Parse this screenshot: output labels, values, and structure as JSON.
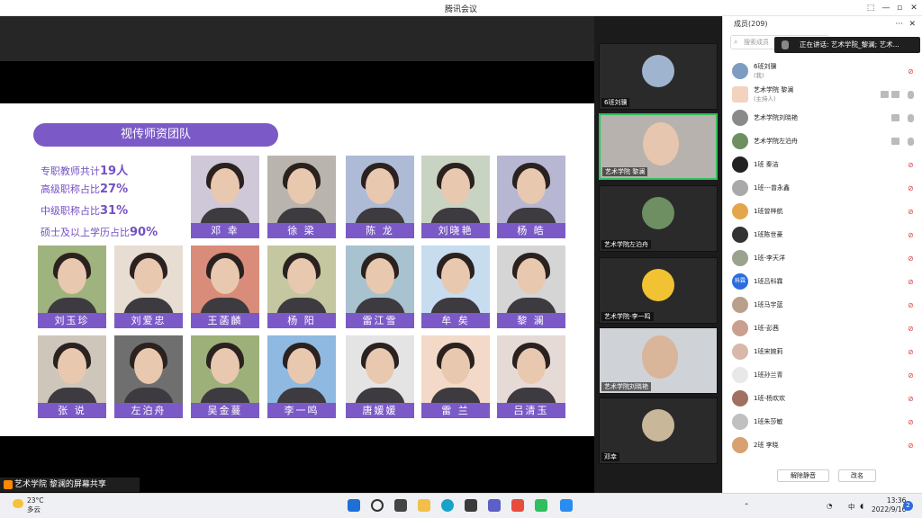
{
  "window": {
    "title": "腾讯会议",
    "controls": [
      "⬚",
      "—",
      "▫",
      "✕"
    ]
  },
  "slide": {
    "title": "视传师资团队",
    "stats": [
      {
        "label": "专职教师共计",
        "value": "19人"
      },
      {
        "label": "高级职称占比",
        "value": "27%"
      },
      {
        "label": "中级职称占比",
        "value": "31%"
      },
      {
        "label": "硕士及以上学历占比",
        "value": "90%"
      }
    ],
    "teachers": [
      "邓 幸",
      "徐 梁",
      "陈 龙",
      "刘晓艳",
      "杨 皓",
      "刘玉珍",
      "刘爱忠",
      "王菡麟",
      "杨 阳",
      "雷江雪",
      "牟 矣",
      "黎 澜",
      "张 说",
      "左泊舟",
      "吴金蔓",
      "李一鸣",
      "唐媛媛",
      "雷 兰",
      "吕清玉"
    ]
  },
  "share_status": "艺术学院 黎澜的屏幕共享",
  "videos": [
    {
      "label": "6班刘骥"
    },
    {
      "label": "艺术学院 黎澜"
    },
    {
      "label": "艺术学院左泊舟"
    },
    {
      "label": "艺术学院-李一鸣"
    },
    {
      "label": "艺术学院刘晓艳"
    },
    {
      "label": "邓幸"
    }
  ],
  "members": {
    "header": "成员(209)",
    "more": "···",
    "close": "✕",
    "search_placeholder": "搜索成员",
    "speaking": "正在讲话: 艺术学院_黎澜; 艺术...",
    "list": [
      {
        "name": "6班刘骥",
        "sub": "(我)",
        "mic": "off"
      },
      {
        "name": "艺术学院 黎澜",
        "sub": "(主持人)",
        "mic": "on"
      },
      {
        "name": "艺术学院刘晓艳",
        "sub": "",
        "mic": "on"
      },
      {
        "name": "艺术学院左泊舟",
        "sub": "",
        "mic": "on"
      },
      {
        "name": "1班 秦洁",
        "sub": "",
        "mic": "off"
      },
      {
        "name": "1班---曾永鑫",
        "sub": "",
        "mic": "off"
      },
      {
        "name": "1班曾梓航",
        "sub": "",
        "mic": "off"
      },
      {
        "name": "1班陈世豪",
        "sub": "",
        "mic": "off"
      },
      {
        "name": "1班-李天洋",
        "sub": "",
        "mic": "off"
      },
      {
        "name": "1班吕科霖",
        "sub": "",
        "mic": "off"
      },
      {
        "name": "1班马宇蓝",
        "sub": "",
        "mic": "off"
      },
      {
        "name": "1班-彭茜",
        "sub": "",
        "mic": "off"
      },
      {
        "name": "1班宋婉莉",
        "sub": "",
        "mic": "off"
      },
      {
        "name": "1班孙兰青",
        "sub": "",
        "mic": "off"
      },
      {
        "name": "1班-杨欢欢",
        "sub": "",
        "mic": "off"
      },
      {
        "name": "1班朱莎敏",
        "sub": "",
        "mic": "off"
      },
      {
        "name": "2班 李晓",
        "sub": "",
        "mic": "off"
      }
    ],
    "avatar_text": "科霖",
    "mute_all": "解除静音",
    "rename": "改名"
  },
  "taskbar": {
    "weather_temp": "23°C",
    "weather_desc": "多云",
    "time": "13:36",
    "date": "2022/9/16",
    "ime": "中",
    "notif": "2"
  }
}
